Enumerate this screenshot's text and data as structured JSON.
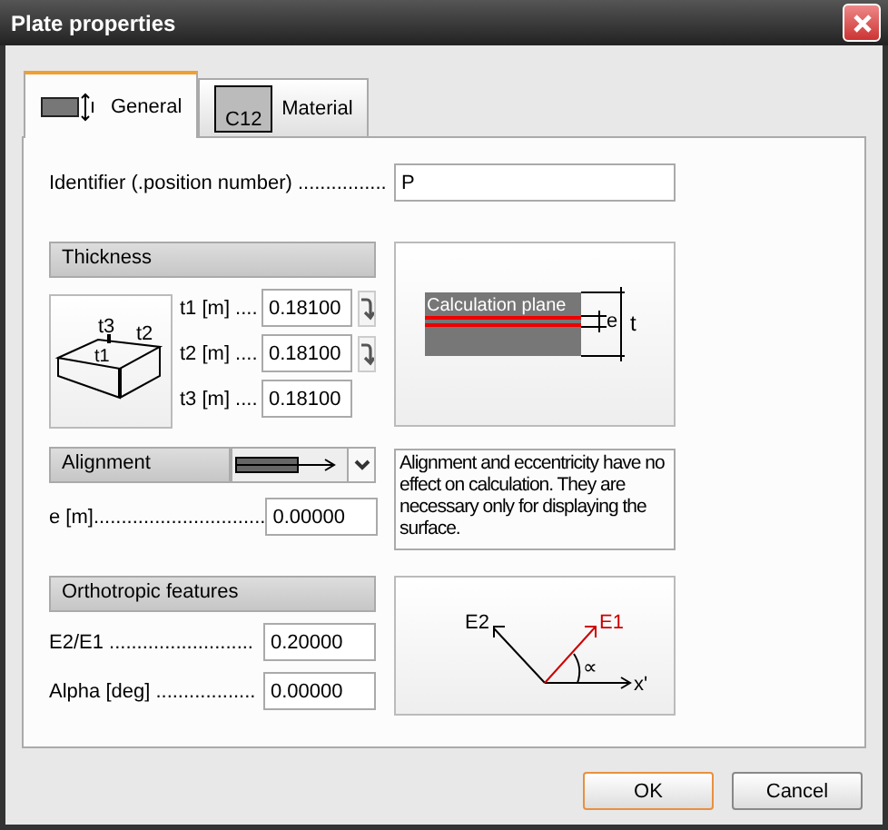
{
  "window": {
    "title": "Plate properties"
  },
  "tabs": [
    {
      "label": "General",
      "selected": true,
      "kind": "general"
    },
    {
      "label": "Material",
      "selected": false,
      "kind": "material",
      "icon_text": "C12"
    }
  ],
  "identifier": {
    "label": "Identifier (.position number) ................",
    "value": "P"
  },
  "thickness": {
    "header": "Thickness",
    "plate_labels": [
      "t3",
      "t2",
      "t1"
    ],
    "fields": [
      {
        "label": "t1 [m] ....",
        "value": "0.18100",
        "linked": true
      },
      {
        "label": "t2 [m] ....",
        "value": "0.18100",
        "linked": true
      },
      {
        "label": "t3 [m] ....",
        "value": "0.18100",
        "linked": false
      }
    ],
    "diagram": {
      "plane": "Calculation plane",
      "e": "e",
      "t": "t"
    }
  },
  "alignment": {
    "header": "Alignment",
    "e_label": "e [m]...............................",
    "e_value": "0.00000",
    "note": "Alignment and eccentricity have no effect on calculation. They are necessary only for displaying the surface."
  },
  "orthotropic": {
    "header": "Orthotropic features",
    "fields": [
      {
        "label": "E2/E1 ..........................",
        "value": "0.20000"
      },
      {
        "label": "Alpha [deg] ..................",
        "value": "0.00000"
      }
    ],
    "axes": {
      "e2": "E2",
      "e1": "E1",
      "angle": "∝",
      "x": "x'"
    }
  },
  "buttons": [
    {
      "label": "OK",
      "default": true
    },
    {
      "label": "Cancel",
      "default": false
    }
  ]
}
